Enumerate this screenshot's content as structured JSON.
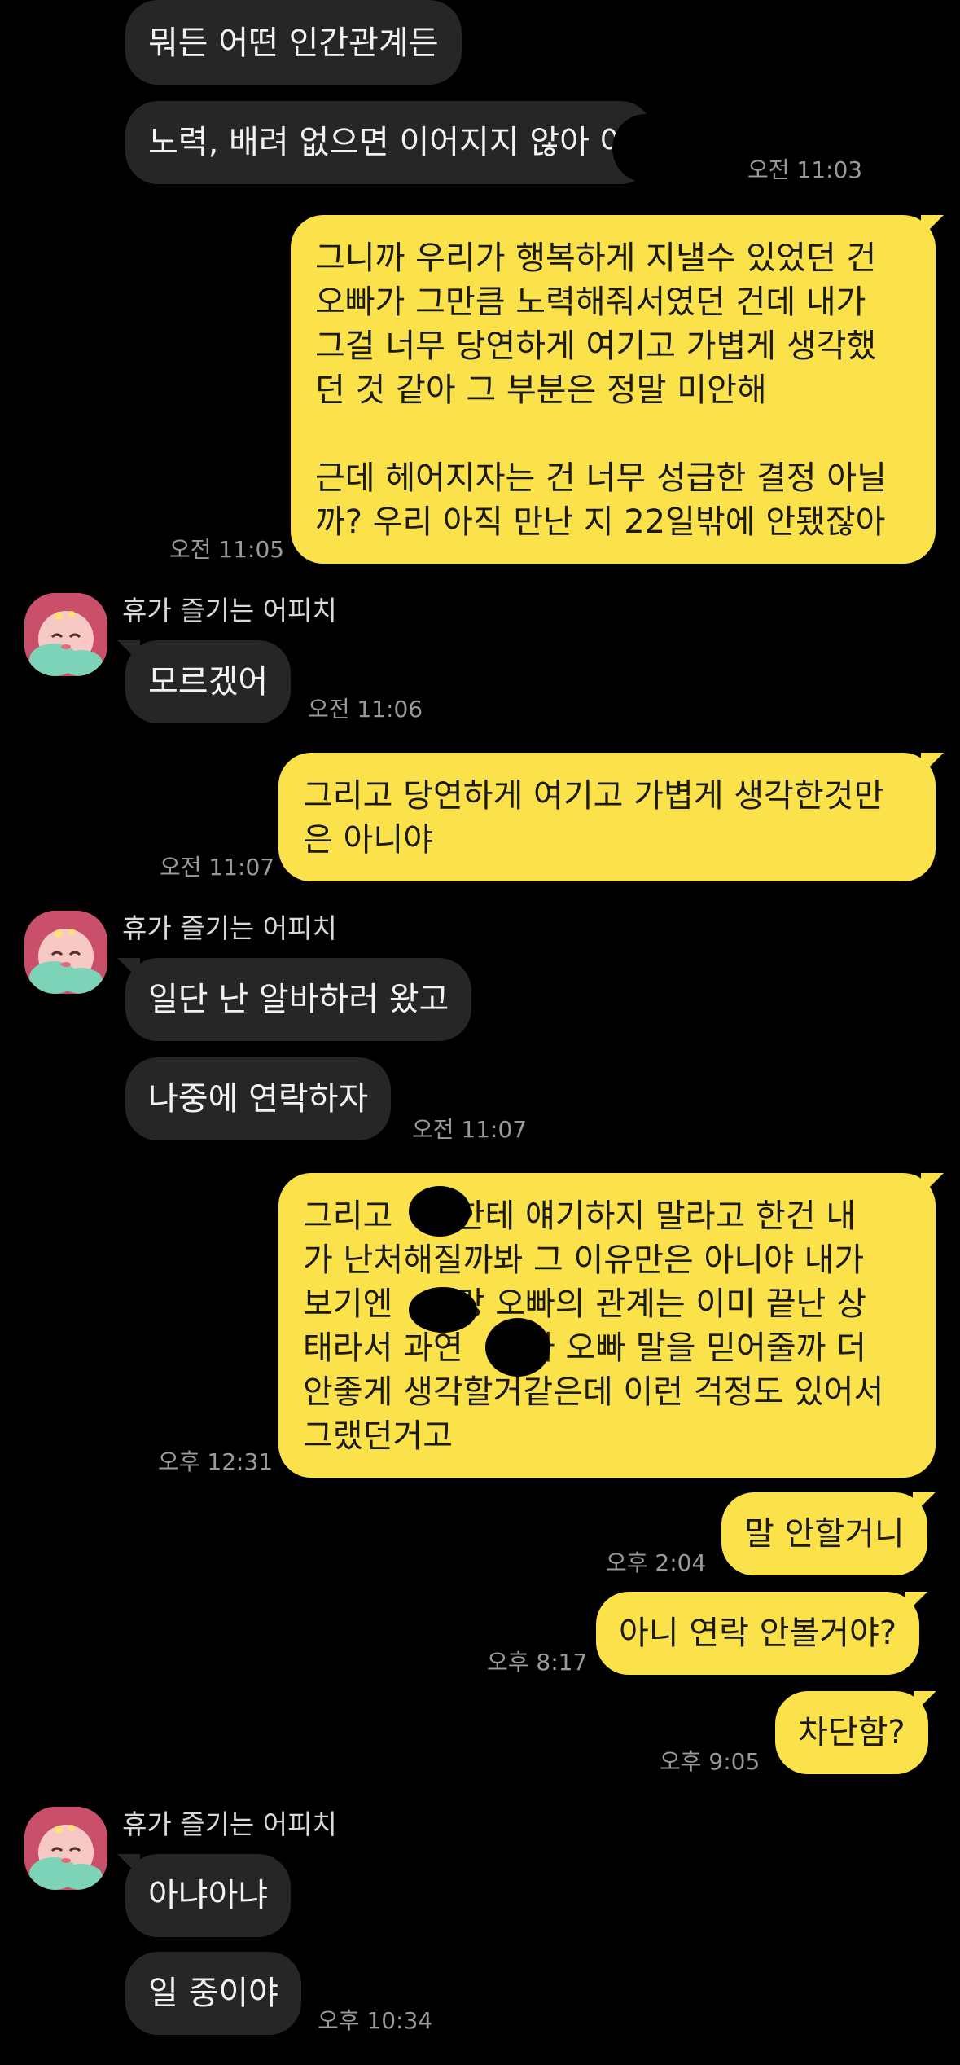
{
  "sender_name": "휴가 즐기는 어피치",
  "avatar_icon": "apeach-avatar-icon",
  "colors": {
    "background": "#000000",
    "incoming_bubble": "#262626",
    "outgoing_bubble": "#fbe24b",
    "timestamp": "#9a9a9a"
  },
  "messages": [
    {
      "id": "m1",
      "dir": "in",
      "text": "뭐든 어떤 인간관계든"
    },
    {
      "id": "m2",
      "dir": "in",
      "text": "노력, 배려 없으면 이어지지 않아      아",
      "time": "오전 11:03"
    },
    {
      "id": "m3",
      "dir": "out",
      "text": "그니까 우리가 행복하게 지낼수 있었던 건\n오빠가 그만큼 노력해줘서였던 건데 내가\n그걸 너무 당연하게 여기고 가볍게 생각했\n던 것 같아 그 부분은 정말 미안해\n\n근데 헤어지자는 건 너무 성급한 결정 아닐\n까? 우리 아직 만난 지 22일밖에 안됐잖아",
      "time": "오전 11:05"
    },
    {
      "id": "m4",
      "dir": "in",
      "text": "모르겠어",
      "time": "오전 11:06"
    },
    {
      "id": "m5",
      "dir": "out",
      "text": "그리고 당연하게 여기고 가볍게 생각한것만\n은 아니야",
      "time": "오전 11:07"
    },
    {
      "id": "m6",
      "dir": "in",
      "text": "일단 난 알바하러 왔고"
    },
    {
      "id": "m7",
      "dir": "in",
      "text": "나중에 연락하자",
      "time": "오전 11:07"
    },
    {
      "id": "m8",
      "dir": "out",
      "text": "그리고      한테 얘기하지 말라고 한건 내\n가 난처해질까봐 그 이유만은 아니야 내가\n보기엔      랑 오빠의 관계는 이미 끝난 상\n태라서 과연      가 오빠 말을 믿어줄까 더\n안좋게 생각할거같은데 이런 걱정도 있어서\n그랬던거고",
      "time": "오후 12:31"
    },
    {
      "id": "m9",
      "dir": "out",
      "text": "말 안할거니",
      "time": "오후 2:04"
    },
    {
      "id": "m10",
      "dir": "out",
      "text": "아니 연락 안볼거야?",
      "time": "오후 8:17"
    },
    {
      "id": "m11",
      "dir": "out",
      "text": "차단함?",
      "time": "오후 9:05"
    },
    {
      "id": "m12",
      "dir": "in",
      "text": "아냐아냐"
    },
    {
      "id": "m13",
      "dir": "in",
      "text": "일 중이야",
      "time": "오후 10:34"
    }
  ]
}
